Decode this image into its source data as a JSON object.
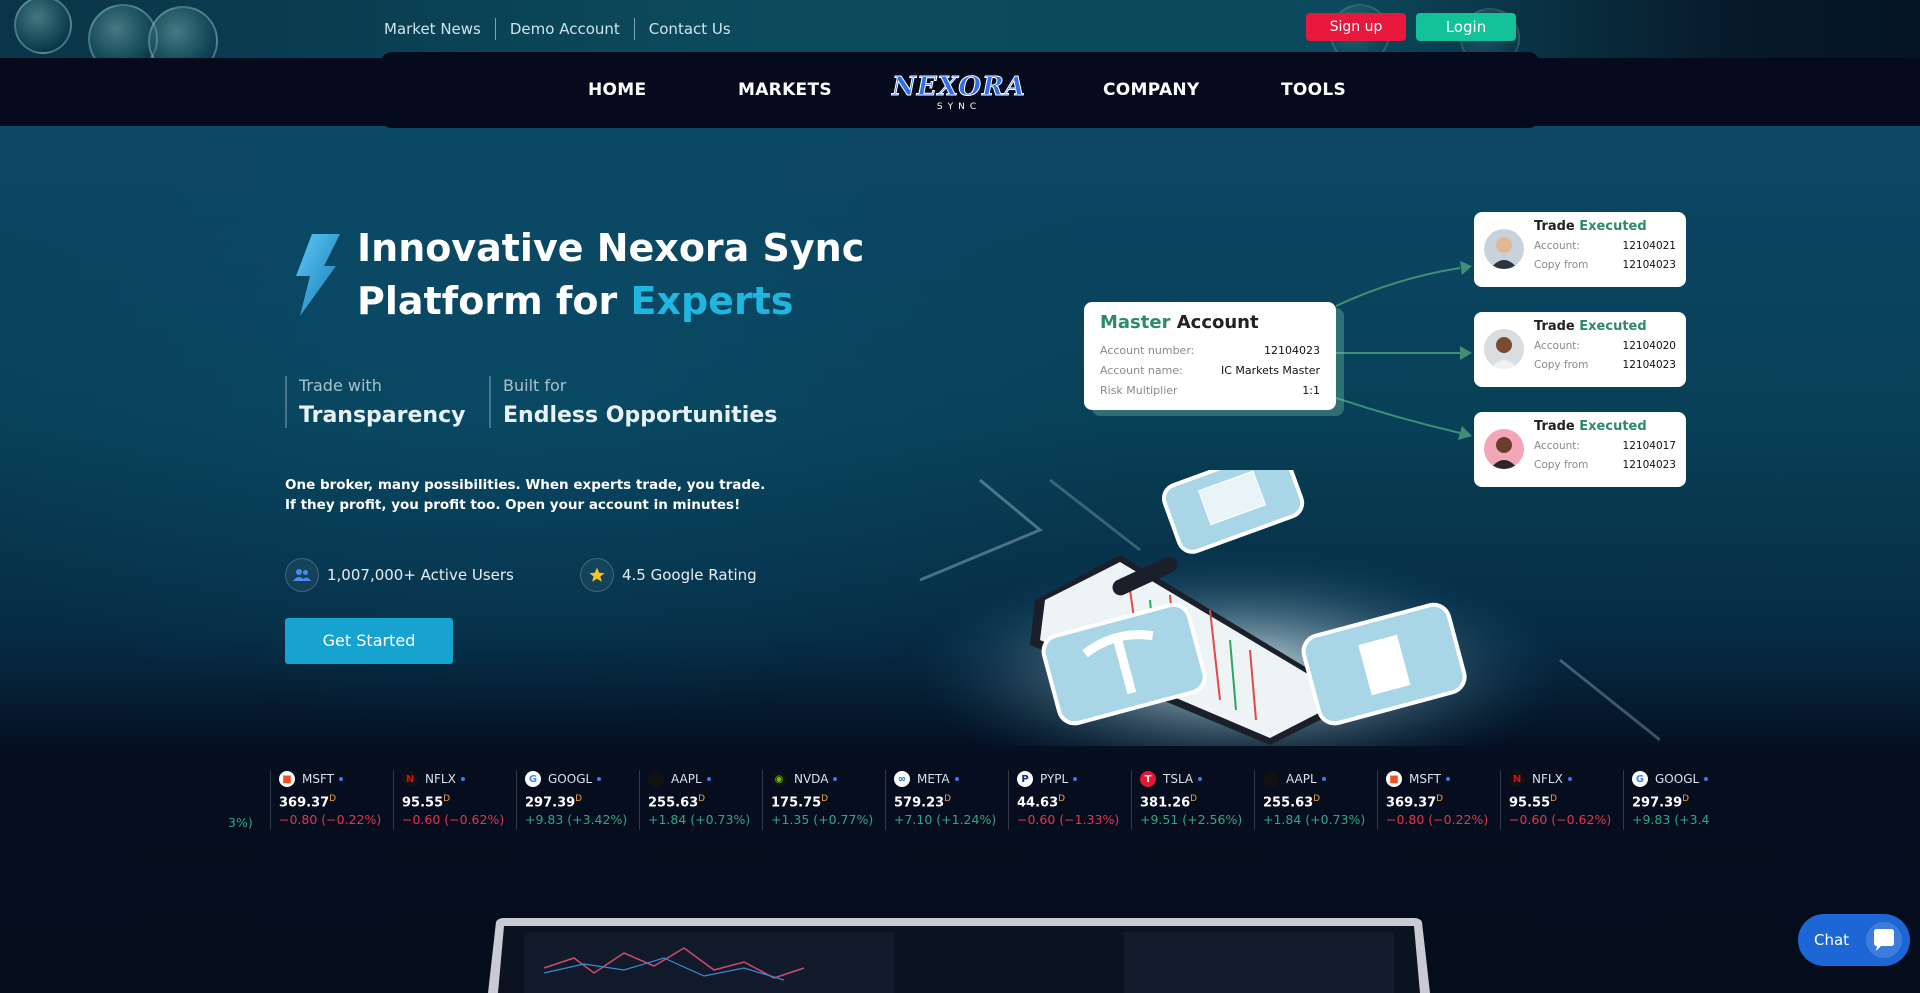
{
  "top_links": [
    "Market News",
    "Demo Account",
    "Contact Us"
  ],
  "auth": {
    "signup": "Sign up",
    "login": "Login"
  },
  "nav": {
    "home": "HOME",
    "markets": "MARKETS",
    "company": "COMPANY",
    "tools": "TOOLS"
  },
  "logo": {
    "main": "NEXORA",
    "sub": "SYNC"
  },
  "hero": {
    "title_line1": "Innovative Nexora Sync",
    "title_line2_prefix": "Platform for ",
    "title_line2_accent": "Experts",
    "features": [
      {
        "small": "Trade with",
        "big": "Transparency"
      },
      {
        "small": "Built for",
        "big": "Endless Opportunities"
      }
    ],
    "desc_line1": "One broker, many possibilities. When experts trade, you trade.",
    "desc_line2": "If they profit, you profit too. Open your account in minutes!",
    "users": "1,007,000+ Active Users",
    "rating": "4.5 Google Rating",
    "cta": "Get Started"
  },
  "master_card": {
    "title_accent": "Master",
    "title_rest": " Account",
    "rows": [
      {
        "k": "Account number:",
        "v": "12104023"
      },
      {
        "k": "Account name:",
        "v": "IC Markets Master"
      },
      {
        "k": "Risk Multiplier",
        "v": "1:1"
      }
    ]
  },
  "trade_cards": [
    {
      "title": "Trade",
      "status": "Executed",
      "account_label": "Account:",
      "account": "12104021",
      "copy_label": "Copy from",
      "copy": "12104023"
    },
    {
      "title": "Trade",
      "status": "Executed",
      "account_label": "Account:",
      "account": "12104020",
      "copy_label": "Copy from",
      "copy": "12104023"
    },
    {
      "title": "Trade",
      "status": "Executed",
      "account_label": "Account:",
      "account": "12104017",
      "copy_label": "Copy from",
      "copy": "12104023"
    }
  ],
  "ticker": [
    {
      "sym": "MSFT",
      "price": "369.37",
      "chg": "−0.80 (−0.22%)",
      "dir": "neg"
    },
    {
      "sym": "NFLX",
      "price": "95.55",
      "chg": "−0.60 (−0.62%)",
      "dir": "neg"
    },
    {
      "sym": "GOOGL",
      "price": "297.39",
      "chg": "+9.83 (+3.42%)",
      "dir": "pos"
    },
    {
      "sym": "AAPL",
      "price": "255.63",
      "chg": "+1.84 (+0.73%)",
      "dir": "pos"
    },
    {
      "sym": "NVDA",
      "price": "175.75",
      "chg": "+1.35 (+0.77%)",
      "dir": "pos"
    },
    {
      "sym": "META",
      "price": "579.23",
      "chg": "+7.10 (+1.24%)",
      "dir": "pos"
    },
    {
      "sym": "PYPL",
      "price": "44.63",
      "chg": "−0.60 (−1.33%)",
      "dir": "neg"
    },
    {
      "sym": "TSLA",
      "price": "381.26",
      "chg": "+9.51 (+2.56%)",
      "dir": "pos"
    },
    {
      "sym": "AAPL",
      "price": "255.63",
      "chg": "+1.84 (+0.73%)",
      "dir": "pos"
    },
    {
      "sym": "MSFT",
      "price": "369.37",
      "chg": "−0.80 (−0.22%)",
      "dir": "neg"
    },
    {
      "sym": "NFLX",
      "price": "95.55",
      "chg": "−0.60 (−0.62%)",
      "dir": "neg"
    },
    {
      "sym": "GOOGL",
      "price": "297.39",
      "chg": "+9.83 (+3.4",
      "dir": "pos"
    }
  ],
  "ticker_partial_left": "3%)",
  "ticker_price_suffix": "D",
  "chat": {
    "label": "Chat"
  },
  "colors": {
    "accent": "#1fb6e0",
    "signup": "#e8173c",
    "login": "#14c29a",
    "positive": "#2ea884",
    "negative": "#e2374a"
  }
}
